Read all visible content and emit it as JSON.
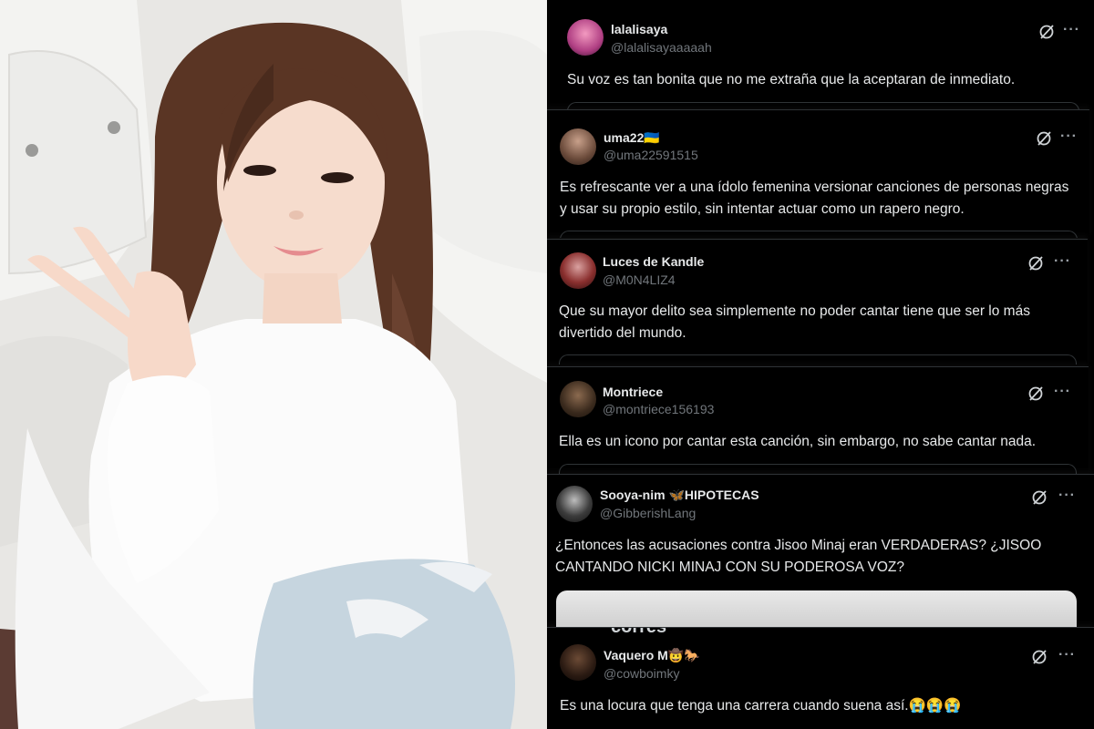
{
  "photo": {
    "alt": "photo-of-woman-peace-sign"
  },
  "colors": {
    "background": "#000000",
    "text": "#e7e9ea",
    "muted": "#71767b"
  },
  "icons": {
    "grok": "grok-slash-circle-icon",
    "more": "more-dots-icon"
  },
  "tweets": [
    {
      "name": "lalalisaya",
      "handle": "@lalalisayaaaaah",
      "text": "Su voz es tan bonita que no me extraña que la aceptaran de inmediato."
    },
    {
      "name": "uma22🇺🇦",
      "handle": "@uma22591515",
      "text": "Es refrescante ver a una ídolo femenina versionar canciones de personas negras y usar su propio estilo, sin intentar actuar como un rapero negro."
    },
    {
      "name": "Luces de Kandle",
      "handle": "@M0N4LIZ4",
      "text": "Que su mayor delito sea simplemente no poder cantar tiene que ser lo más divertido del mundo."
    },
    {
      "name": "Montriece",
      "handle": "@montriece156193",
      "text": "Ella es un icono por cantar esta canción, sin embargo, no sabe cantar nada."
    },
    {
      "name": "Sooya-nim 🦋HIPOTECAS",
      "handle": "@GibberishLang",
      "text": "¿Entonces las acusaciones contra Jisoo Minaj eran VERDADERAS? ¿JISOO CANTANDO NICKI MINAJ CON SU PODEROSA VOZ?"
    },
    {
      "name": "Vaquero M🤠🐎",
      "handle": "@cowboimky",
      "text": "Es una locura que tenga una carrera cuando suena así.😭😭😭"
    }
  ],
  "more_label": "···",
  "cutoff_text": "corres"
}
